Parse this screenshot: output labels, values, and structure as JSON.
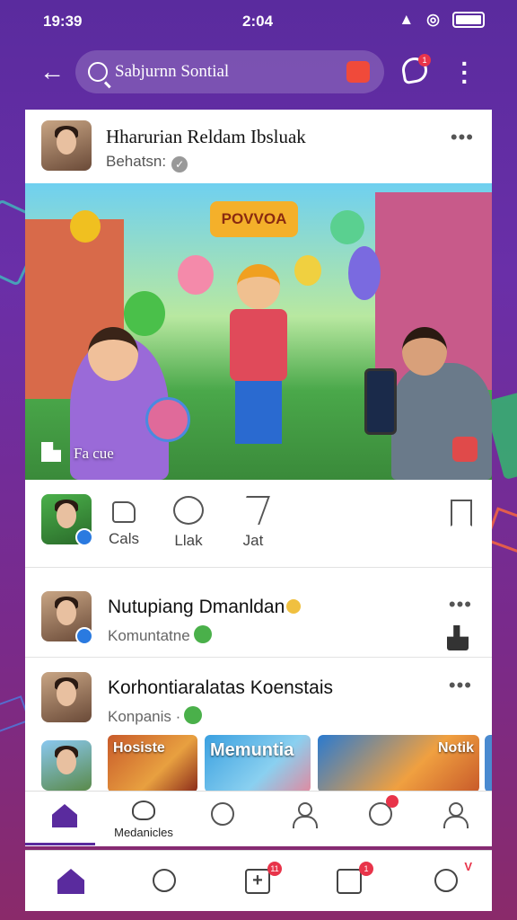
{
  "status_bar": {
    "time": "19:39",
    "center_time": "2:04"
  },
  "top_bar": {
    "search_text": "Sabjurnn Sontial",
    "notif_badge": "1"
  },
  "post": {
    "author_name": "Hharurian Reldam Ibsluak",
    "author_sub": "Behatsn:",
    "image_sign": "POVVOA",
    "image_caption": "Fa cue"
  },
  "actions": {
    "items": [
      {
        "label": "Cals",
        "icon": "like-icon"
      },
      {
        "label": "Llak",
        "icon": "comment-icon"
      },
      {
        "label": "Jat",
        "icon": "share-icon"
      }
    ]
  },
  "comments": [
    {
      "name": "Nutupiang Dmanldan",
      "sub": "Komuntatne"
    },
    {
      "name": "Korhontiaralatas Koenstais",
      "sub": "Konpanis ·"
    }
  ],
  "thumbnails": [
    {
      "label": "Hosiste"
    },
    {
      "label": "Memuntia"
    },
    {
      "label": "Notik"
    }
  ],
  "tabbar": {
    "active_label": "Medanicles"
  },
  "bottom_nav": {
    "create_badge": "11",
    "messages_badge": "1",
    "profile_badge": "V"
  },
  "colors": {
    "accent": "#5a2b9e",
    "badge_red": "#e8344a"
  }
}
